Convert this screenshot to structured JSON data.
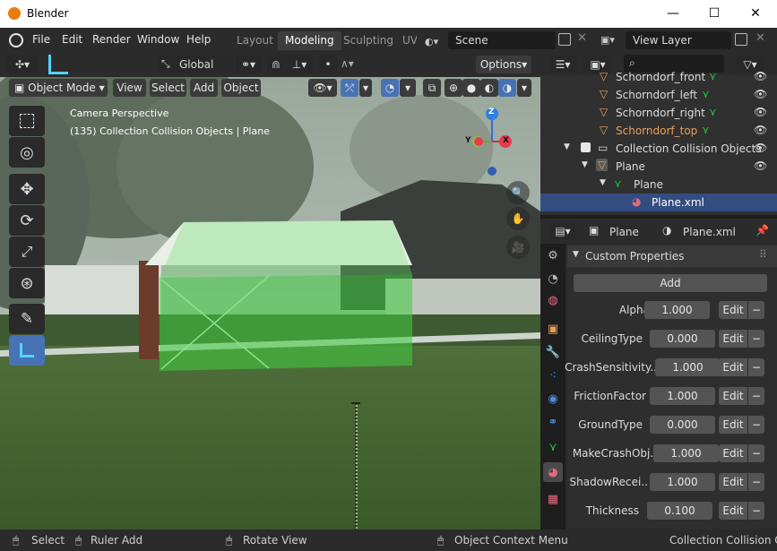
{
  "window": {
    "title": "Blender",
    "minimize": "—",
    "maximize": "☐",
    "close": "✕"
  },
  "menu": {
    "items": [
      "File",
      "Edit",
      "Render",
      "Window",
      "Help"
    ],
    "workspaces": [
      "Layout",
      "Modeling",
      "Sculpting",
      "UV"
    ],
    "active_workspace": "Modeling",
    "scene": "Scene",
    "view_layer": "View Layer"
  },
  "viewport_header": {
    "orientation": "Global",
    "options": "Options",
    "mode": "Object Mode",
    "menus": [
      "View",
      "Select",
      "Add",
      "Object"
    ]
  },
  "viewport": {
    "overlay_line1": "Camera Perspective",
    "overlay_line2": "(135) Collection Collision Objects | Plane",
    "gizmo": {
      "z": "Z",
      "y": "Y",
      "x": "X"
    }
  },
  "outliner": {
    "search_placeholder": "",
    "items": [
      {
        "label": "Schorndorf_front",
        "type": "object",
        "color": "#e8a05a"
      },
      {
        "label": "Schorndorf_left",
        "type": "object",
        "color": "#dcdcdc"
      },
      {
        "label": "Schorndorf_right",
        "type": "object",
        "color": "#dcdcdc"
      },
      {
        "label": "Schorndorf_top",
        "type": "object",
        "color": "#e8a05a"
      },
      {
        "label": "Collection Collision Objects",
        "type": "collection",
        "color": "#dcdcdc"
      },
      {
        "label": "Plane",
        "type": "object",
        "color": "#dcdcdc"
      },
      {
        "label": "Plane",
        "type": "mesh",
        "color": "#dcdcdc"
      },
      {
        "label": "Plane.xml",
        "type": "material",
        "color": "#dcdcdc",
        "selected": true
      }
    ]
  },
  "properties": {
    "object": "Plane",
    "material": "Plane.xml",
    "panel": "Custom Properties",
    "add": "Add",
    "edit_label": "Edit",
    "minus": "−",
    "rows": [
      {
        "label": "Alpha",
        "value": "1.000"
      },
      {
        "label": "CeilingType",
        "value": "0.000"
      },
      {
        "label": "CrashSensitivity..",
        "value": "1.000"
      },
      {
        "label": "FrictionFactor",
        "value": "1.000"
      },
      {
        "label": "GroundType",
        "value": "0.000"
      },
      {
        "label": "MakeCrashObj..",
        "value": "1.000"
      },
      {
        "label": "ShadowRecei..",
        "value": "1.000"
      },
      {
        "label": "Thickness",
        "value": "0.100"
      }
    ]
  },
  "statusbar": {
    "select": "Select",
    "ruler": "Ruler Add",
    "rotate": "Rotate View",
    "context": "Object Context Menu",
    "collection": "Collection Collision Obj"
  },
  "colors": {
    "accent": "#4772b3",
    "header": "#2b2b2b",
    "selected_row": "#334d80",
    "orange": "#e8a05a",
    "green_mesh": "#1ec840"
  }
}
